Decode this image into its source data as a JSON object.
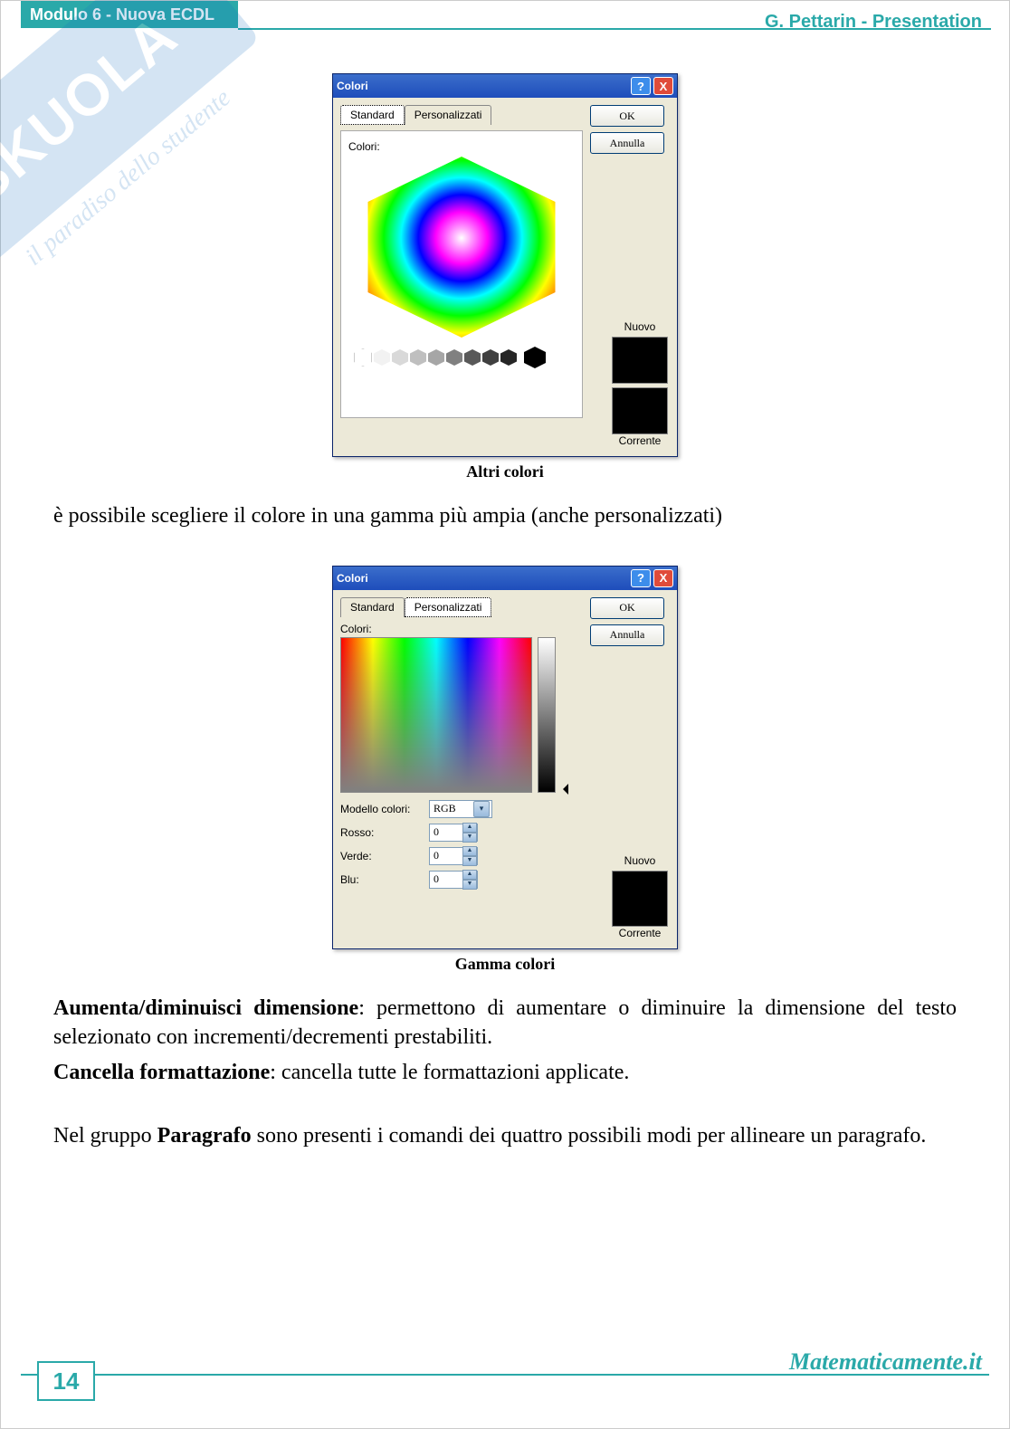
{
  "header": {
    "module": "Modulo 6 - Nuova ECDL",
    "author": "G. Pettarin - Presentation"
  },
  "watermark": {
    "brand": "SKUOLA",
    "tag": "il paradiso dello studente"
  },
  "sec1": {
    "dialog": {
      "title": "Colori",
      "help": "?",
      "close": "X",
      "tab_standard": "Standard",
      "tab_custom": "Personalizzati",
      "colors_label": "Colori:",
      "ok": "OK",
      "cancel": "Annulla",
      "new": "Nuovo",
      "current": "Corrente",
      "grays": [
        "#ffffff",
        "#f2f2f2",
        "#d9d9d9",
        "#bfbfbf",
        "#a6a6a6",
        "#808080",
        "#595959",
        "#404040",
        "#262626",
        "#000000"
      ]
    },
    "caption": "Altri colori",
    "para": "è possibile scegliere il colore in una gamma più ampia (anche personalizzati)"
  },
  "sec2": {
    "dialog": {
      "title": "Colori",
      "help": "?",
      "close": "X",
      "tab_standard": "Standard",
      "tab_custom": "Personalizzati",
      "colors_label": "Colori:",
      "ok": "OK",
      "cancel": "Annulla",
      "model_label": "Modello colori:",
      "model_value": "RGB",
      "r_label": "Rosso:",
      "r_value": "0",
      "g_label": "Verde:",
      "g_value": "0",
      "b_label": "Blu:",
      "b_value": "0",
      "new": "Nuovo",
      "current": "Corrente"
    },
    "caption": "Gamma colori"
  },
  "body": {
    "p1_b": "Aumenta/diminuisci dimensione",
    "p1": ": permettono di aumentare o diminuire la dimensione del testo selezionato con incrementi/decrementi prestabiliti.",
    "p2_b": "Cancella formattazione",
    "p2": ": cancella tutte le formattazioni applicate.",
    "p3a": "Nel gruppo ",
    "p3_b": "Paragrafo",
    "p3b": " sono presenti i comandi dei quattro possibili modi per allineare un paragrafo."
  },
  "footer": {
    "site": "Matematicamente.it",
    "page": "14"
  }
}
